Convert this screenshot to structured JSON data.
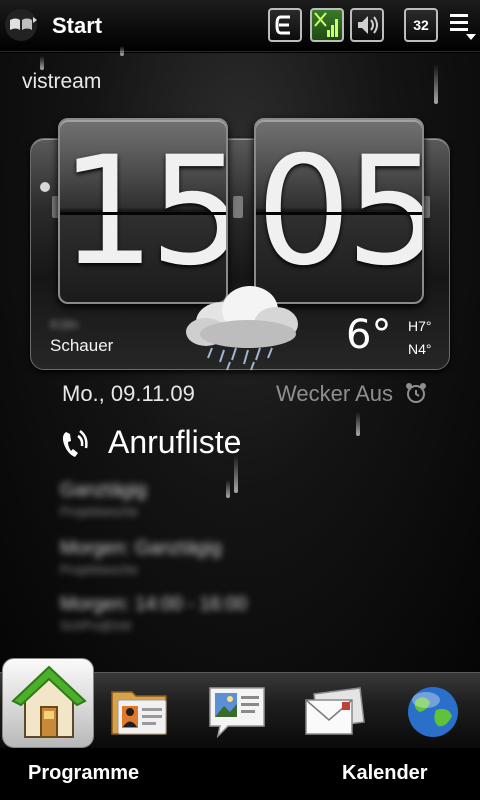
{
  "statusbar": {
    "title": "Start",
    "battery_level_text": "32",
    "icons": [
      "windows-logo",
      "data-connection-e-icon",
      "signal-strength-icon",
      "volume-icon",
      "battery-icon",
      "menu-icon"
    ]
  },
  "user": {
    "name": "vistream"
  },
  "clock": {
    "hours": "15",
    "minutes": "05"
  },
  "weather": {
    "city": "Köln",
    "condition": "Schauer",
    "temperature": "6°",
    "high": "H7°",
    "low": "N4°",
    "icon": "rain-cloud-icon"
  },
  "date": {
    "text": "Mo., 09.11.09",
    "alarm": "Wecker Aus"
  },
  "calls": {
    "title": "Anrufliste",
    "entries": [
      {
        "title": "Ganztägig",
        "subtitle": "Projektwoche"
      },
      {
        "title": "Morgen: Ganztägig",
        "subtitle": "Projektwoche"
      },
      {
        "title": "Morgen: 14:00 - 16:00",
        "subtitle": "SchProjEintr"
      }
    ]
  },
  "dock": {
    "items": [
      "home-icon",
      "contacts-icon",
      "photo-message-icon",
      "mail-icon",
      "internet-globe-icon"
    ]
  },
  "softkeys": {
    "left": "Programme",
    "right": "Kalender"
  },
  "colors": {
    "background": "#000000",
    "text": "#ffffff",
    "dim_text": "#8f8f8f",
    "home_tile": "#e6e6e6"
  }
}
